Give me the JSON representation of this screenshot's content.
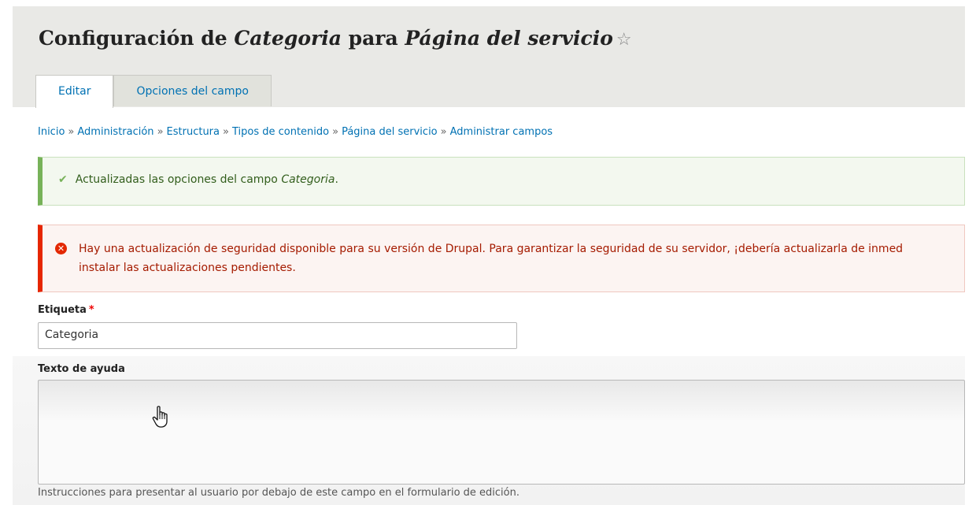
{
  "page": {
    "title_part1": "Configuración de ",
    "title_field": "Categoria",
    "title_part2": " para ",
    "title_type": "Página del servicio",
    "star_icon": "star-outline-icon"
  },
  "tabs": [
    {
      "label": "Editar",
      "active": true
    },
    {
      "label": "Opciones del campo",
      "active": false
    }
  ],
  "breadcrumb": [
    "Inicio",
    "Administración",
    "Estructura",
    "Tipos de contenido",
    "Página del servicio",
    "Administrar campos"
  ],
  "breadcrumb_separator": "»",
  "messages": {
    "status": {
      "prefix": "Actualizadas las opciones del campo ",
      "field": "Categoria",
      "suffix": "."
    },
    "error": {
      "line1": "Hay una actualización de seguridad disponible para su versión de Drupal. Para garantizar la seguridad de su servidor, ¡debería actualizarla de inmed",
      "line2": "instalar las actualizaciones pendientes."
    }
  },
  "form": {
    "label_field": {
      "label": "Etiqueta",
      "required_marker": "*",
      "value": "Categoria"
    },
    "help_field": {
      "label": "Texto de ayuda",
      "value": "",
      "description": "Instrucciones para presentar al usuario por debajo de este campo en el formulario de edición."
    }
  },
  "colors": {
    "link": "#0071b3",
    "status_border": "#77b259",
    "error_border": "#e62600"
  }
}
